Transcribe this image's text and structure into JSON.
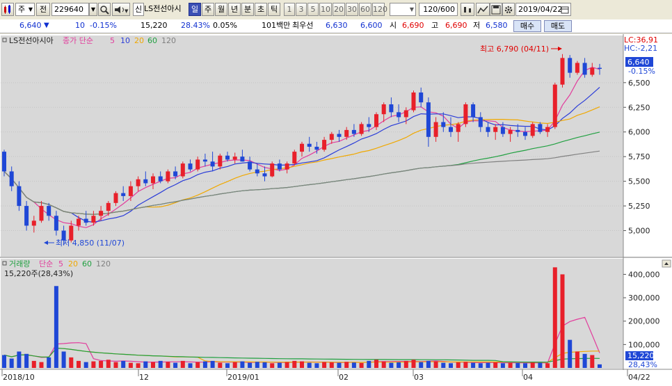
{
  "toolbar": {
    "type_label": "주",
    "code_prefix": "전",
    "code": "229640",
    "credit_badge": "신",
    "stock_name": "LS전선아시",
    "periods": [
      "일",
      "주",
      "월",
      "년",
      "분",
      "초",
      "틱"
    ],
    "selected_period": "일",
    "intervals": [
      "1",
      "3",
      "5",
      "10",
      "20",
      "30",
      "60",
      "120"
    ],
    "count_value": "120",
    "count_total": "/600",
    "date": "2019/04/22"
  },
  "quote": {
    "price": "6,640",
    "direction": "▼",
    "change": "10",
    "change_pct": "-0.15%",
    "volume": "15,220",
    "volume_ratio": "28.43%",
    "turnover": "0.05%",
    "trade_value": "101백만",
    "best_label": "최우선",
    "ask": "6,630",
    "bid": "6,600",
    "open_label": "시",
    "open": "6,690",
    "high_label": "고",
    "high": "6,690",
    "low_label": "저",
    "low": "6,580",
    "buy_label": "매수",
    "sell_label": "매도"
  },
  "price_panel": {
    "title": "LS전선아시아",
    "ma_label": "종가 단순",
    "ma_periods": [
      "5",
      "10",
      "20",
      "60",
      "120"
    ],
    "lc_text": "LC:36,91",
    "hc_text": "HC:-2,21",
    "current_badge": "6,640",
    "current_pct": "-0.15%",
    "high_annotation": "최고 6,790 (04/11)",
    "low_annotation": "최저 4,850 (11/07)",
    "y_ticks": [
      "6,500",
      "6,250",
      "6,000",
      "5,750",
      "5,500",
      "5,250",
      "5,000"
    ]
  },
  "volume_panel": {
    "title": "거래량",
    "ma_label": "단순",
    "ma_periods": [
      "5",
      "20",
      "60",
      "120"
    ],
    "current_text": "15,220주(28,43%)",
    "y_ticks": [
      "400,000",
      "300,000",
      "200,000",
      "100,000"
    ],
    "current_badge": "15,220",
    "current_pct": "28,43%"
  },
  "x_axis": {
    "labels": [
      "2018/10",
      "12",
      "2019/01",
      "02",
      "03",
      "04",
      "04/22"
    ]
  },
  "colors": {
    "up": "#e8202a",
    "down": "#1f47d6",
    "ma5": "#e23c9c",
    "ma10": "#2a3cd8",
    "ma20": "#f0a800",
    "ma60": "#20a040",
    "ma120": "#808080"
  },
  "chart_data": {
    "type": "candlestick",
    "price_range": [
      4750,
      6950
    ],
    "volume_range": [
      0,
      440000
    ],
    "ohlc": [
      [
        5800,
        5820,
        5550,
        5600
      ],
      [
        5600,
        5650,
        5400,
        5450
      ],
      [
        5450,
        5500,
        5200,
        5250
      ],
      [
        5250,
        5300,
        5000,
        5050
      ],
      [
        5050,
        5150,
        4980,
        5100
      ],
      [
        5100,
        5300,
        5080,
        5250
      ],
      [
        5250,
        5280,
        5100,
        5150
      ],
      [
        5150,
        5200,
        4950,
        5000
      ],
      [
        5000,
        5050,
        4850,
        4900
      ],
      [
        4900,
        5100,
        4880,
        5050
      ],
      [
        5050,
        5150,
        5000,
        5120
      ],
      [
        5120,
        5200,
        5050,
        5080
      ],
      [
        5080,
        5200,
        5050,
        5150
      ],
      [
        5150,
        5250,
        5100,
        5200
      ],
      [
        5200,
        5300,
        5150,
        5280
      ],
      [
        5280,
        5400,
        5250,
        5380
      ],
      [
        5380,
        5450,
        5300,
        5350
      ],
      [
        5350,
        5500,
        5300,
        5450
      ],
      [
        5450,
        5550,
        5400,
        5520
      ],
      [
        5520,
        5600,
        5450,
        5480
      ],
      [
        5480,
        5580,
        5420,
        5550
      ],
      [
        5550,
        5600,
        5480,
        5500
      ],
      [
        5500,
        5620,
        5480,
        5600
      ],
      [
        5600,
        5650,
        5520,
        5550
      ],
      [
        5550,
        5700,
        5530,
        5680
      ],
      [
        5680,
        5720,
        5600,
        5620
      ],
      [
        5620,
        5750,
        5600,
        5720
      ],
      [
        5720,
        5780,
        5650,
        5700
      ],
      [
        5700,
        5800,
        5600,
        5650
      ],
      [
        5650,
        5780,
        5620,
        5760
      ],
      [
        5760,
        5800,
        5700,
        5720
      ],
      [
        5720,
        5790,
        5680,
        5750
      ],
      [
        5750,
        5820,
        5700,
        5700
      ],
      [
        5700,
        5750,
        5600,
        5620
      ],
      [
        5620,
        5680,
        5550,
        5580
      ],
      [
        5580,
        5650,
        5500,
        5550
      ],
      [
        5550,
        5700,
        5540,
        5680
      ],
      [
        5680,
        5720,
        5600,
        5620
      ],
      [
        5620,
        5700,
        5580,
        5680
      ],
      [
        5680,
        5820,
        5660,
        5800
      ],
      [
        5800,
        5900,
        5750,
        5880
      ],
      [
        5880,
        5950,
        5800,
        5850
      ],
      [
        5850,
        5900,
        5780,
        5820
      ],
      [
        5820,
        5950,
        5800,
        5920
      ],
      [
        5920,
        6000,
        5880,
        5980
      ],
      [
        5980,
        6020,
        5900,
        5950
      ],
      [
        5950,
        6050,
        5920,
        6020
      ],
      [
        6020,
        6080,
        5950,
        5980
      ],
      [
        5980,
        6100,
        5960,
        6080
      ],
      [
        6080,
        6150,
        6000,
        6050
      ],
      [
        6050,
        6200,
        6020,
        6180
      ],
      [
        6180,
        6300,
        6100,
        6280
      ],
      [
        6280,
        6350,
        6150,
        6200
      ],
      [
        6200,
        6280,
        6100,
        6150
      ],
      [
        6150,
        6250,
        6080,
        6220
      ],
      [
        6220,
        6420,
        6200,
        6400
      ],
      [
        6400,
        6450,
        6250,
        6300
      ],
      [
        6300,
        6350,
        5850,
        5950
      ],
      [
        5950,
        6150,
        5900,
        6100
      ],
      [
        6100,
        6200,
        6000,
        6050
      ],
      [
        6050,
        6150,
        5950,
        6000
      ],
      [
        6000,
        6100,
        5900,
        6080
      ],
      [
        6080,
        6300,
        6050,
        6280
      ],
      [
        6280,
        6300,
        6100,
        6150
      ],
      [
        6150,
        6200,
        6000,
        6050
      ],
      [
        6050,
        6100,
        5950,
        6000
      ],
      [
        6000,
        6080,
        5920,
        6050
      ],
      [
        6050,
        6100,
        5950,
        5980
      ],
      [
        5980,
        6050,
        5900,
        6020
      ],
      [
        6020,
        6080,
        5950,
        6000
      ],
      [
        6000,
        6050,
        5920,
        5960
      ],
      [
        5960,
        6100,
        5940,
        6080
      ],
      [
        6080,
        6100,
        5980,
        6000
      ],
      [
        6000,
        6080,
        5950,
        6050
      ],
      [
        6050,
        6500,
        6030,
        6480
      ],
      [
        6480,
        6790,
        6450,
        6750
      ],
      [
        6750,
        6780,
        6550,
        6600
      ],
      [
        6600,
        6720,
        6580,
        6700
      ],
      [
        6700,
        6750,
        6550,
        6580
      ],
      [
        6580,
        6700,
        6560,
        6650
      ],
      [
        6650,
        6690,
        6580,
        6640
      ]
    ],
    "volume": [
      55000,
      40000,
      70000,
      60000,
      30000,
      25000,
      45000,
      350000,
      70000,
      45000,
      30000,
      25000,
      28000,
      30000,
      35000,
      25000,
      30000,
      22000,
      20000,
      28000,
      25000,
      30000,
      26000,
      22000,
      30000,
      20000,
      25000,
      28000,
      30000,
      22000,
      20000,
      25000,
      28000,
      22000,
      26000,
      24000,
      20000,
      22000,
      25000,
      30000,
      28000,
      22000,
      20000,
      25000,
      24000,
      22000,
      26000,
      23000,
      21000,
      30000,
      35000,
      28000,
      22000,
      24000,
      30000,
      35000,
      25000,
      30000,
      28000,
      22000,
      20000,
      24000,
      26000,
      22000,
      20000,
      22000,
      24000,
      20000,
      22000,
      21000,
      20000,
      23000,
      22000,
      20000,
      430000,
      400000,
      120000,
      70000,
      60000,
      55000,
      15220
    ]
  }
}
